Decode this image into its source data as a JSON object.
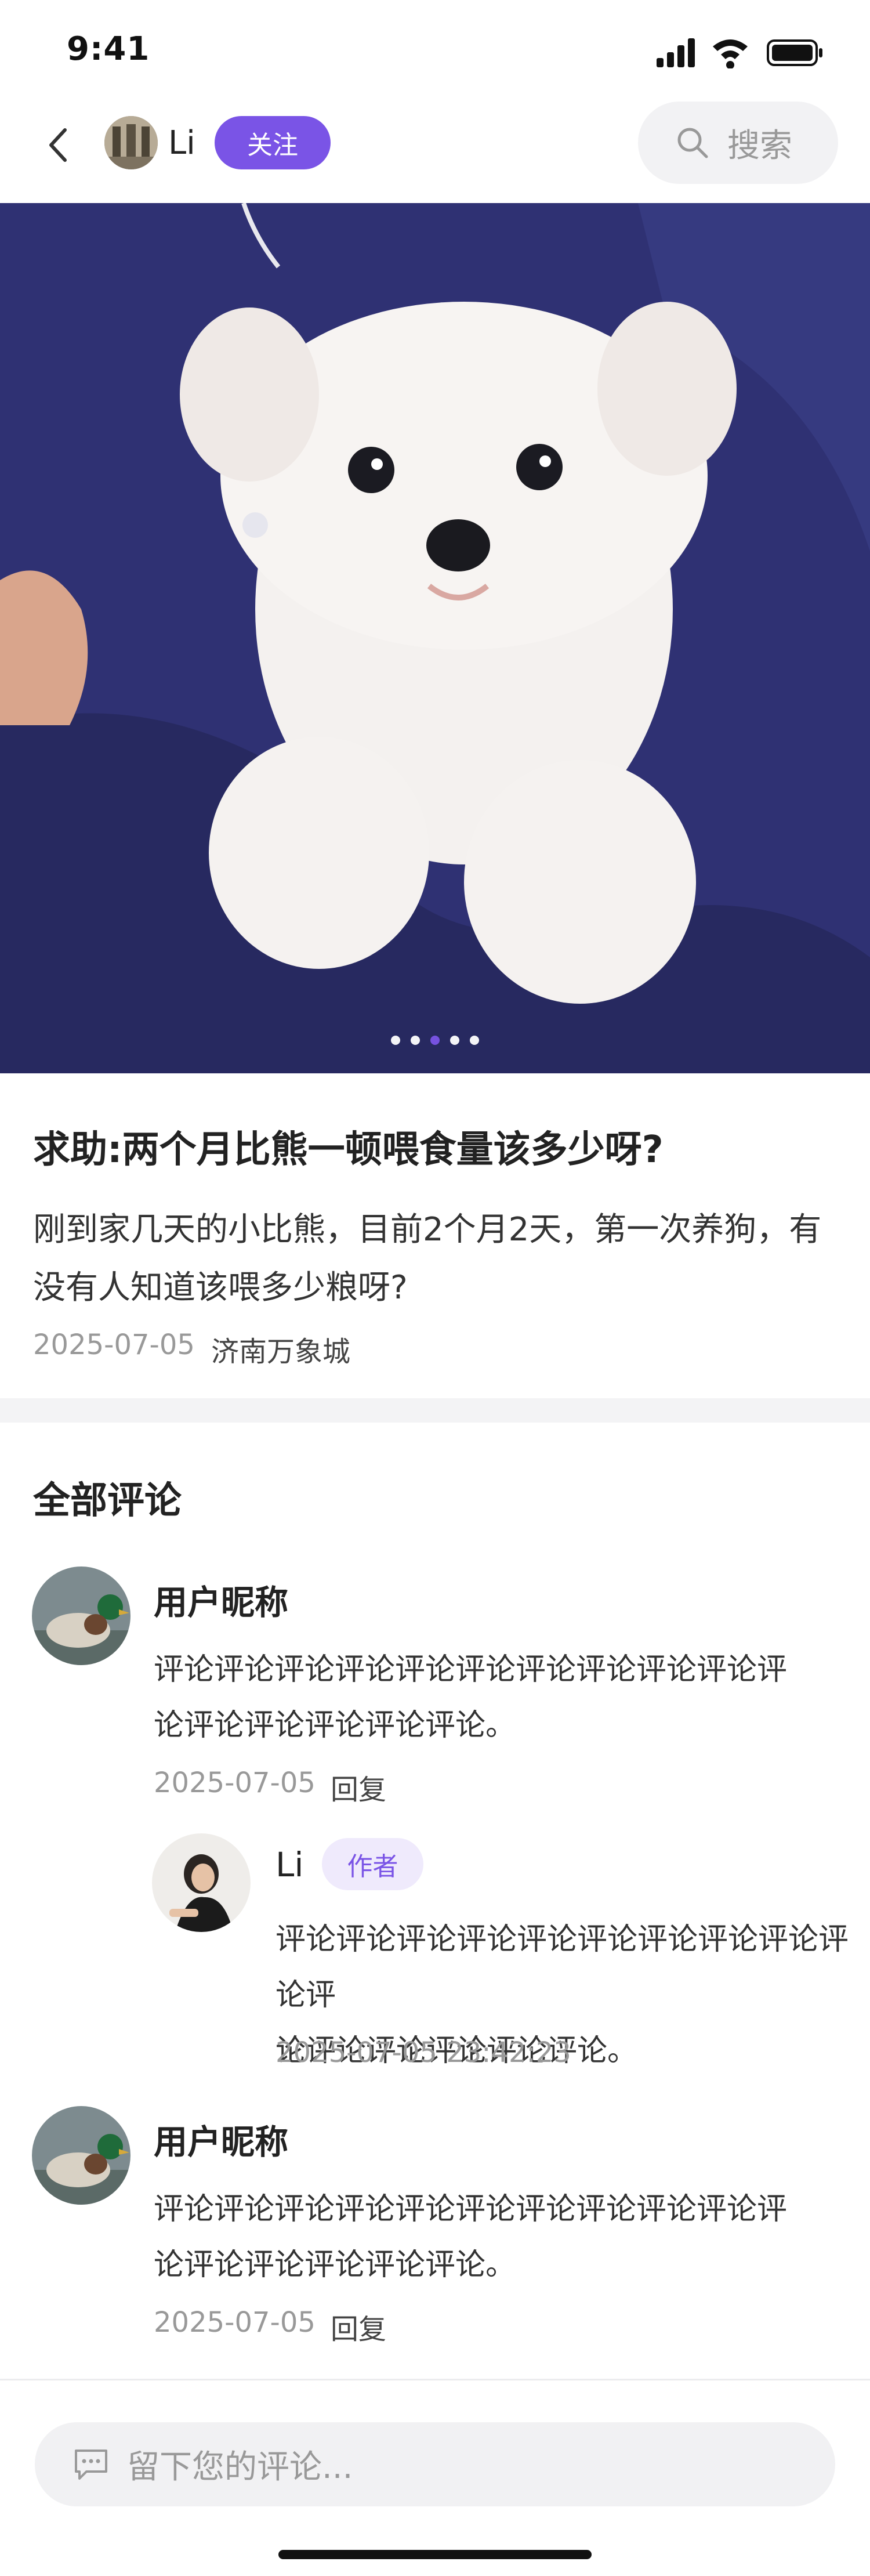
{
  "status_bar": {
    "time": "9:41"
  },
  "nav": {
    "user_name": "Li",
    "follow_label": "关注",
    "search_label": "搜索"
  },
  "carousel": {
    "count": 5,
    "active": 3
  },
  "post": {
    "title": "求助:两个月比熊一顿喂食量该多少呀?",
    "body": "刚到家几天的小比熊，目前2个月2天，第一次养狗，有没有人知道该喂多少粮呀?",
    "date": "2025-07-05",
    "location": "济南万象城"
  },
  "comments_header": "全部评论",
  "comments": [
    {
      "name": "用户昵称",
      "text_line1": "评论评论评论评论评论评论评论评论评论评论评",
      "text_line2": "论评论评论评论评论评论。",
      "date": "2025-07-05",
      "reply_label": "回复",
      "reply": {
        "name": "Li",
        "badge": "作者",
        "text_line1": "评论评论评论评论评论评论评论评论评论评论评",
        "text_line2": "论评论评论评论评论评论。",
        "datetime": "2025-07-05 23:42:23"
      }
    },
    {
      "name": "用户昵称",
      "text_line1": "评论评论评论评论评论评论评论评论评论评论评",
      "text_line2": "论评论评论评论评论评论。",
      "date": "2025-07-05",
      "reply_label": "回复"
    }
  ],
  "input": {
    "placeholder": "留下您的评论..."
  },
  "colors": {
    "accent": "#7a54e6",
    "accent_light": "#efeafc",
    "band": "#f3f3f5"
  }
}
